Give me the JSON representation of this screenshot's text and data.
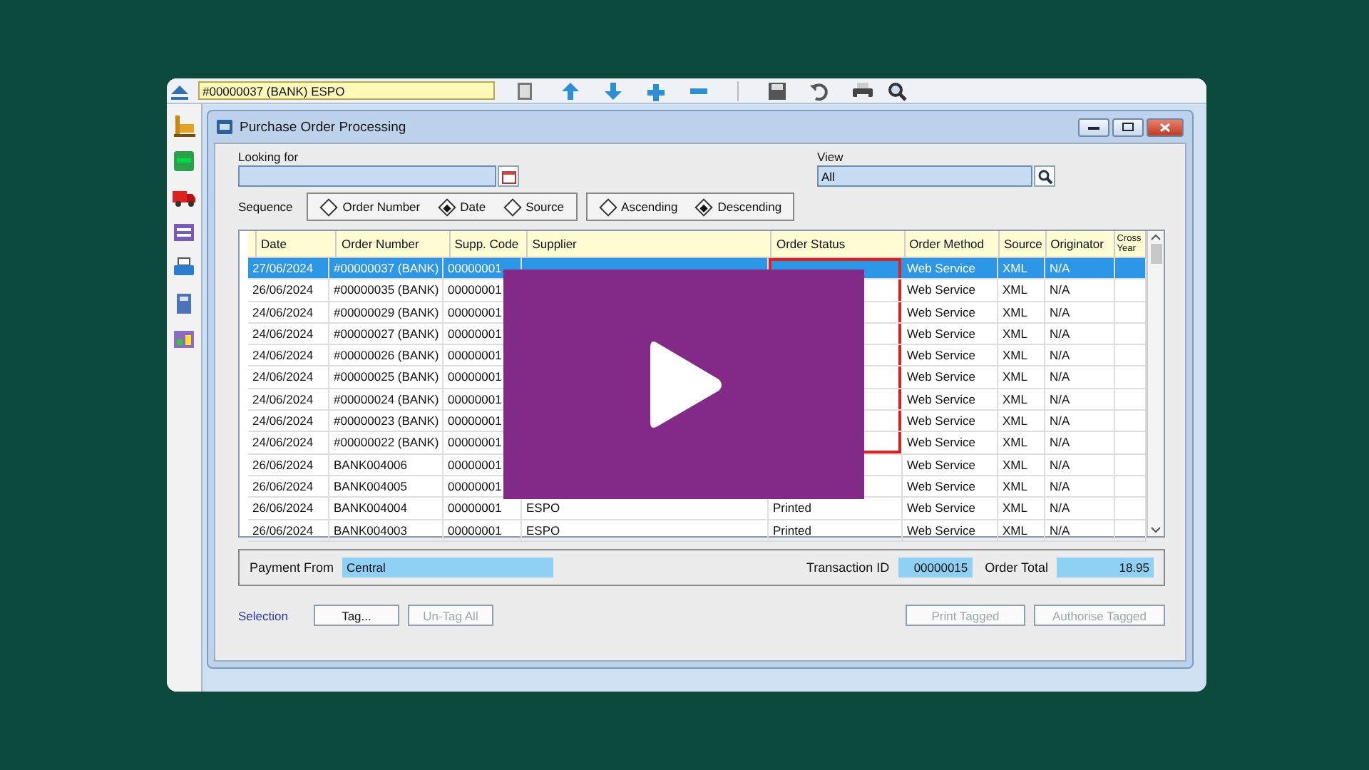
{
  "toolbar": {
    "record_field": "#00000037 (BANK) ESPO"
  },
  "window": {
    "title": "Purchase Order Processing"
  },
  "search": {
    "looking_for_label": "Looking for",
    "view_label": "View",
    "view_value": "All"
  },
  "sequence": {
    "label": "Sequence",
    "options": [
      {
        "label": "Order Number",
        "selected": false
      },
      {
        "label": "Date",
        "selected": true
      },
      {
        "label": "Source",
        "selected": false
      }
    ]
  },
  "direction": [
    {
      "label": "Ascending",
      "selected": false
    },
    {
      "label": "Descending",
      "selected": true
    }
  ],
  "table": {
    "columns": [
      "Date",
      "Order Number",
      "Supp. Code",
      "Supplier",
      "Order Status",
      "Order Method",
      "Source",
      "Originator",
      "Cross Year"
    ],
    "rows": [
      {
        "date": "27/06/2024",
        "order_number": "#00000037 (BANK)",
        "supp_code": "00000001",
        "order_method": "Web Service",
        "source": "XML",
        "originator": "N/A",
        "selected": true,
        "annotated": true
      },
      {
        "date": "26/06/2024",
        "order_number": "#00000035 (BANK)",
        "supp_code": "00000001",
        "order_method": "Web Service",
        "source": "XML",
        "originator": "N/A",
        "selected": false,
        "annotated": true
      },
      {
        "date": "24/06/2024",
        "order_number": "#00000029 (BANK)",
        "supp_code": "00000001",
        "order_method": "Web Service",
        "source": "XML",
        "originator": "N/A",
        "selected": false,
        "annotated": true
      },
      {
        "date": "24/06/2024",
        "order_number": "#00000027 (BANK)",
        "supp_code": "00000001",
        "order_method": "Web Service",
        "source": "XML",
        "originator": "N/A",
        "selected": false,
        "annotated": true
      },
      {
        "date": "24/06/2024",
        "order_number": "#00000026 (BANK)",
        "supp_code": "00000001",
        "order_method": "Web Service",
        "source": "XML",
        "originator": "N/A",
        "selected": false,
        "annotated": true
      },
      {
        "date": "24/06/2024",
        "order_number": "#00000025 (BANK)",
        "supp_code": "00000001",
        "order_method": "Web Service",
        "source": "XML",
        "originator": "N/A",
        "selected": false,
        "annotated": true
      },
      {
        "date": "24/06/2024",
        "order_number": "#00000024 (BANK)",
        "supp_code": "00000001",
        "order_method": "Web Service",
        "source": "XML",
        "originator": "N/A",
        "selected": false,
        "annotated": true
      },
      {
        "date": "24/06/2024",
        "order_number": "#00000023 (BANK)",
        "supp_code": "00000001",
        "order_method": "Web Service",
        "source": "XML",
        "originator": "N/A",
        "selected": false,
        "annotated": true
      },
      {
        "date": "24/06/2024",
        "order_number": "#00000022 (BANK)",
        "supp_code": "00000001",
        "order_method": "Web Service",
        "source": "XML",
        "originator": "N/A",
        "selected": false,
        "annotated": true
      },
      {
        "date": "26/06/2024",
        "order_number": "BANK004006",
        "supp_code": "00000001",
        "order_method": "Web Service",
        "source": "XML",
        "originator": "N/A",
        "selected": false,
        "annotated": false
      },
      {
        "date": "26/06/2024",
        "order_number": "BANK004005",
        "supp_code": "00000001",
        "order_method": "Web Service",
        "source": "XML",
        "originator": "N/A",
        "selected": false,
        "annotated": false
      },
      {
        "date": "26/06/2024",
        "order_number": "BANK004004",
        "supp_code": "00000001",
        "supplier": "ESPO",
        "order_status": "Printed",
        "order_method": "Web Service",
        "source": "XML",
        "originator": "N/A",
        "selected": false,
        "annotated": false
      },
      {
        "date": "26/06/2024",
        "order_number": "BANK004003",
        "supp_code": "00000001",
        "supplier": "ESPO",
        "order_status": "Printed",
        "order_method": "Web Service",
        "source": "XML",
        "originator": "N/A",
        "selected": false,
        "annotated": false
      }
    ]
  },
  "summary": {
    "payment_from_label": "Payment From",
    "payment_from": "Central",
    "transaction_id_label": "Transaction ID",
    "transaction_id": "00000015",
    "order_total_label": "Order Total",
    "order_total": "18.95"
  },
  "selection_label": "Selection",
  "left_buttons": [
    {
      "label": "Tag...",
      "disabled": false
    },
    {
      "label": "Un-Tag All",
      "disabled": true
    }
  ],
  "right_buttons": [
    {
      "label": "Print Tagged",
      "disabled": true
    },
    {
      "label": "Authorise Tagged",
      "disabled": true
    }
  ]
}
